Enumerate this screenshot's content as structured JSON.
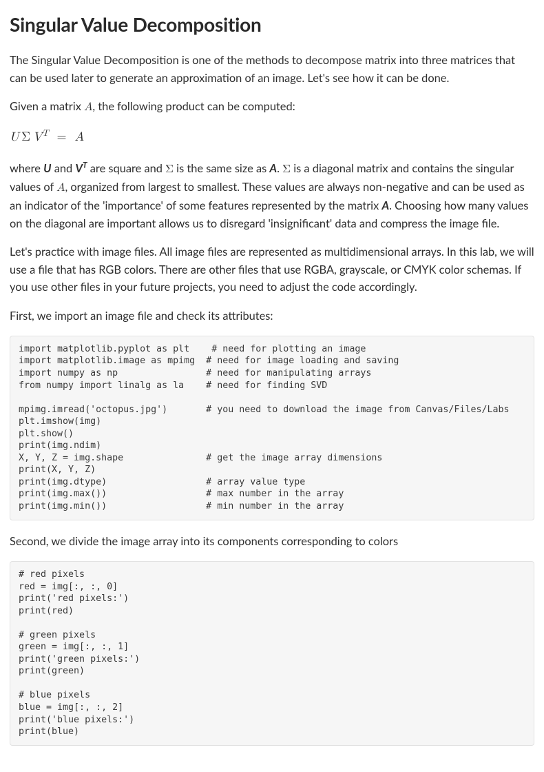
{
  "title": "Singular Value Decomposition",
  "para1": "The Singular Value Decomposition is one of the methods to decompose matrix into three matrices that can be used later to generate an approximation of an image. Let's see how it can be done.",
  "para2_pre": "Given a matrix ",
  "para2_A": "A",
  "para2_post": ", the following product can be computed:",
  "eq": {
    "U": "U",
    "Sigma": "Σ",
    "V": "V",
    "T": "T",
    "eq": "=",
    "A": "A"
  },
  "para3": {
    "t1": "where ",
    "U": "U",
    "t2": " and ",
    "VT": "V",
    "VT_T": "T",
    "t3": " are square and ",
    "Sigma": "Σ",
    "t4": " is the same size as ",
    "A1": "A",
    "t5": ". ",
    "Sigma2": "Σ",
    "t6": " is a diagonal matrix and contains the singular values of ",
    "A2": "A",
    "t7": ", organized from largest to smallest. These values are always non-negative and can be used as an indicator of the 'importance' of some features represented by the matrix ",
    "A3": "A",
    "t8": ". Choosing how many values on the diagonal are important allows us to disregard 'insignificant' data and compress the image file."
  },
  "para4": "Let's practice with image files. All image files are represented as multidimensional arrays. In this lab, we will use a file that has RGB colors. There are other files that use RGBA, grayscale, or CMYK color schemas. If you use other files in your future projects, you need to adjust the code accordingly.",
  "para5": "First, we import an image file and check its attributes:",
  "code1": "import matplotlib.pyplot as plt    # need for plotting an image\nimport matplotlib.image as mpimg  # need for image loading and saving\nimport numpy as np                # need for manipulating arrays\nfrom numpy import linalg as la    # need for finding SVD\n\nmpimg.imread('octopus.jpg')       # you need to download the image from Canvas/Files/Labs\nplt.imshow(img)\nplt.show()\nprint(img.ndim)\nX, Y, Z = img.shape               # get the image array dimensions\nprint(X, Y, Z)\nprint(img.dtype)                  # array value type\nprint(img.max())                  # max number in the array\nprint(img.min())                  # min number in the array",
  "para6": "Second, we divide the image array into its components corresponding to colors",
  "code2": "# red pixels\nred = img[:, :, 0]\nprint('red pixels:')\nprint(red)\n\n# green pixels\ngreen = img[:, :, 1]\nprint('green pixels:')\nprint(green)\n\n# blue pixels\nblue = img[:, :, 2]\nprint('blue pixels:')\nprint(blue)"
}
